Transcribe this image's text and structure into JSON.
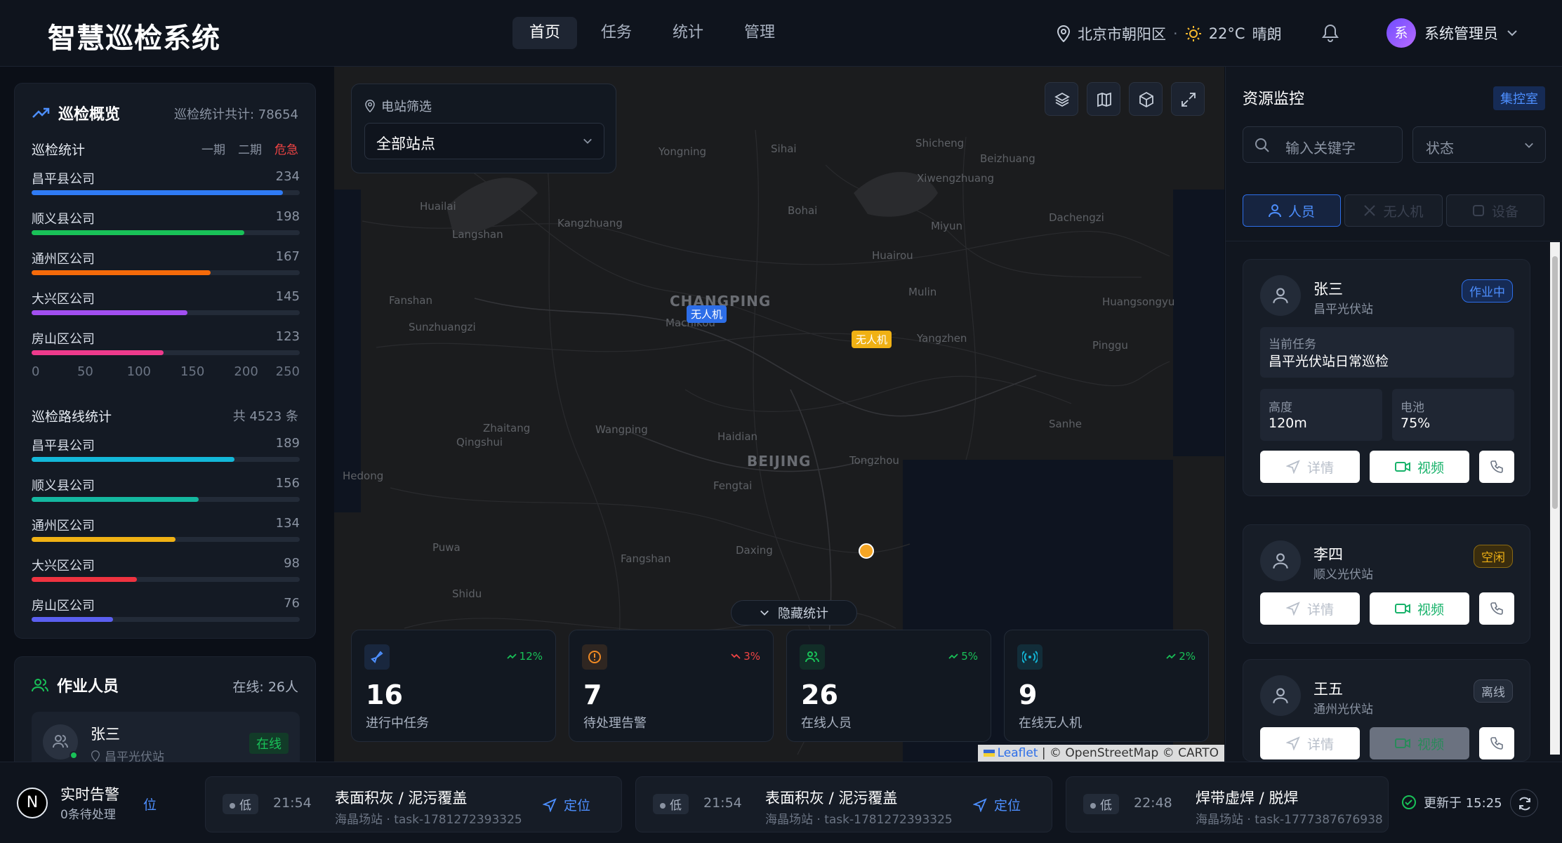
{
  "header": {
    "logo": "智慧巡检系统",
    "nav": [
      "首页",
      "任务",
      "统计",
      "管理"
    ],
    "location": "北京市朝阳区",
    "weather_temp": "22°C",
    "weather_desc": "晴朗",
    "user_initial": "系",
    "user_name": "系统管理员"
  },
  "overview": {
    "title": "巡检概览",
    "total": "巡检统计共计: 78654",
    "stats_title": "巡检统计",
    "legend": [
      "一期",
      "二期",
      "危急"
    ],
    "bars": [
      {
        "label": "昌平县公司",
        "value": 234,
        "color": "#2f7bf5"
      },
      {
        "label": "顺义县公司",
        "value": 198,
        "color": "#19c158"
      },
      {
        "label": "通州区公司",
        "value": 167,
        "color": "#f56a0a"
      },
      {
        "label": "大兴区公司",
        "value": 145,
        "color": "#a24ff0"
      },
      {
        "label": "房山区公司",
        "value": 123,
        "color": "#ee3a8c"
      }
    ],
    "axis": [
      "0",
      "50",
      "100",
      "150",
      "200",
      "250"
    ],
    "axis_max": 250,
    "route_title": "巡检路线统计",
    "route_total": "共 4523 条",
    "route_bars": [
      {
        "label": "昌平县公司",
        "value": 189,
        "color": "#13b8d8"
      },
      {
        "label": "顺义县公司",
        "value": 156,
        "color": "#14b8a0"
      },
      {
        "label": "通州区公司",
        "value": 134,
        "color": "#f0b114"
      },
      {
        "label": "大兴区公司",
        "value": 98,
        "color": "#ef3340"
      },
      {
        "label": "房山区公司",
        "value": 76,
        "color": "#5b5ff0"
      }
    ],
    "route_max": 250
  },
  "workers": {
    "title": "作业人员",
    "online": "在线: 26人",
    "first_name": "张三",
    "first_site": "昌平光伏站",
    "first_status": "在线"
  },
  "map": {
    "filter_label": "电站筛选",
    "filter_value": "全部站点",
    "labels": [
      "Yongning",
      "Sihai",
      "Shicheng",
      "Beizhuang",
      "Xiwengzhuang",
      "Huailai",
      "Langshan",
      "Kangzhuang",
      "Bohai",
      "Miyun",
      "Dachengzi",
      "Huairou",
      "Mulin",
      "Fanshan",
      "Sunzhuangzi",
      "Machikou",
      "Yangzhen",
      "Huangsongyu",
      "Pinggu",
      "Zhaitang",
      "Qingshui",
      "Wangping",
      "Haidian",
      "Sanhe",
      "Tongzhou",
      "Hedong",
      "Fengtai",
      "Puwa",
      "Fangshan",
      "Daxing",
      "Shidu"
    ],
    "big_labels": [
      "CHANGPING",
      "BEIJING"
    ],
    "drone_tag": "无人机",
    "hide_stats": "隐藏统计",
    "attribution_leaflet": "Leaflet",
    "attribution_rest": "| © OpenStreetMap © CARTO",
    "stats": [
      {
        "num": "16",
        "label": "进行中任务",
        "trend": "12%",
        "up": true,
        "color": "#4d8fff"
      },
      {
        "num": "7",
        "label": "待处理告警",
        "trend": "3%",
        "up": false,
        "color": "#f08a24"
      },
      {
        "num": "26",
        "label": "在线人员",
        "trend": "5%",
        "up": true,
        "color": "#19c158"
      },
      {
        "num": "9",
        "label": "在线无人机",
        "trend": "2%",
        "up": true,
        "color": "#13b8d8"
      }
    ]
  },
  "resource": {
    "title": "资源监控",
    "control_room": "集控室",
    "search_placeholder": "输入关键字",
    "state_label": "状态",
    "tabs": [
      "人员",
      "无人机",
      "设备"
    ],
    "people": [
      {
        "name": "张三",
        "site": "昌平光伏站",
        "status": "作业中",
        "task_label": "当前任务",
        "task": "昌平光伏站日常巡检",
        "height_label": "高度",
        "height": "120m",
        "battery_label": "电池",
        "battery": "75%"
      },
      {
        "name": "李四",
        "site": "顺义光伏站",
        "status": "空闲"
      },
      {
        "name": "王五",
        "site": "通州光伏站",
        "status": "离线"
      }
    ],
    "detail": "详情",
    "video": "视频"
  },
  "bottom": {
    "logo_letter": "N",
    "title": "实时告警",
    "pending": "0条待处理",
    "partial_locate": "位",
    "updated": "更新于 15:25",
    "alerts": [
      {
        "level": "低",
        "time": "21:54",
        "title": "表面积灰 / 泥污覆盖",
        "sub": "海晶场站 · task-1781272393325",
        "locate": "定位"
      },
      {
        "level": "低",
        "time": "21:54",
        "title": "表面积灰 / 泥污覆盖",
        "sub": "海晶场站 · task-1781272393325",
        "locate": "定位"
      },
      {
        "level": "低",
        "time": "22:48",
        "title": "焊带虚焊 / 脱焊",
        "sub": "海晶场站 · task-1777387676938",
        "locate": "定位"
      }
    ]
  }
}
